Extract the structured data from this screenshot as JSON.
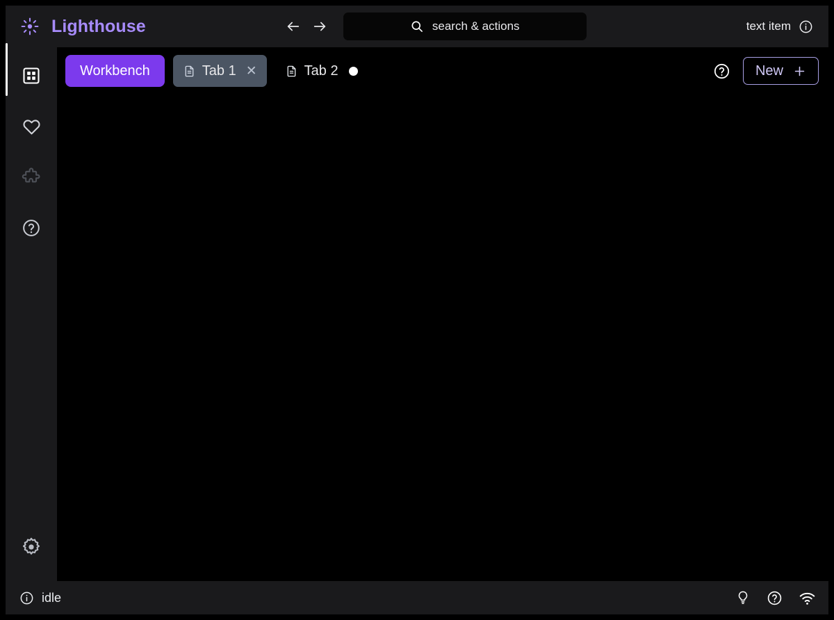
{
  "app": {
    "title": "Lighthouse",
    "logo_icon": "sun-brightness-icon",
    "accent_color": "#7c3aed",
    "brand_text_color": "#a78bfa",
    "background_color": "#000000",
    "chrome_color": "#1a1a1c"
  },
  "header": {
    "back_icon": "arrow-left-icon",
    "forward_icon": "arrow-right-icon",
    "search": {
      "icon": "search-icon",
      "placeholder": "search & actions",
      "value": ""
    },
    "right_item": {
      "label": "text item",
      "icon": "info-circle-icon"
    }
  },
  "sidebar": {
    "items": [
      {
        "name": "dashboard",
        "icon": "grid-icon",
        "active": true
      },
      {
        "name": "favorites",
        "icon": "heart-icon",
        "active": false
      },
      {
        "name": "extensions",
        "icon": "puzzle-icon",
        "active": false
      },
      {
        "name": "help",
        "icon": "question-circle-icon",
        "active": false
      }
    ],
    "bottom_item": {
      "name": "settings",
      "icon": "gear-icon"
    }
  },
  "tabbar": {
    "workbench_label": "Workbench",
    "tabs": [
      {
        "label": "Tab 1",
        "icon": "file-icon",
        "active": true,
        "closable": true,
        "close_icon": "close-icon",
        "modified": false
      },
      {
        "label": "Tab 2",
        "icon": "file-icon",
        "active": false,
        "closable": false,
        "modified": true,
        "modified_icon": "dot-indicator"
      }
    ],
    "help_icon": "question-circle-icon",
    "new_button": {
      "label": "New",
      "icon": "plus-icon"
    }
  },
  "statusbar": {
    "status_icon": "info-circle-icon",
    "status_text": "idle",
    "right_icons": [
      {
        "name": "lightbulb-icon"
      },
      {
        "name": "question-circle-icon"
      },
      {
        "name": "wifi-icon"
      }
    ]
  }
}
